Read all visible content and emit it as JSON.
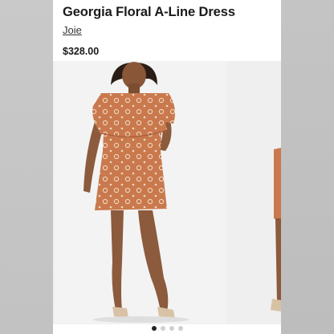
{
  "product": {
    "title": "Georgia Floral A-Line Dress",
    "brand": "Joie",
    "price": "$328.00"
  },
  "gallery": {
    "image_count": 4,
    "active_index": 0,
    "main_image": "model-wearing-orange-floral-dress",
    "next_image": "model-side-view-partial"
  },
  "colors": {
    "dress": "#c9794d",
    "background": "#ffffff",
    "text": "#1a1a1a"
  }
}
